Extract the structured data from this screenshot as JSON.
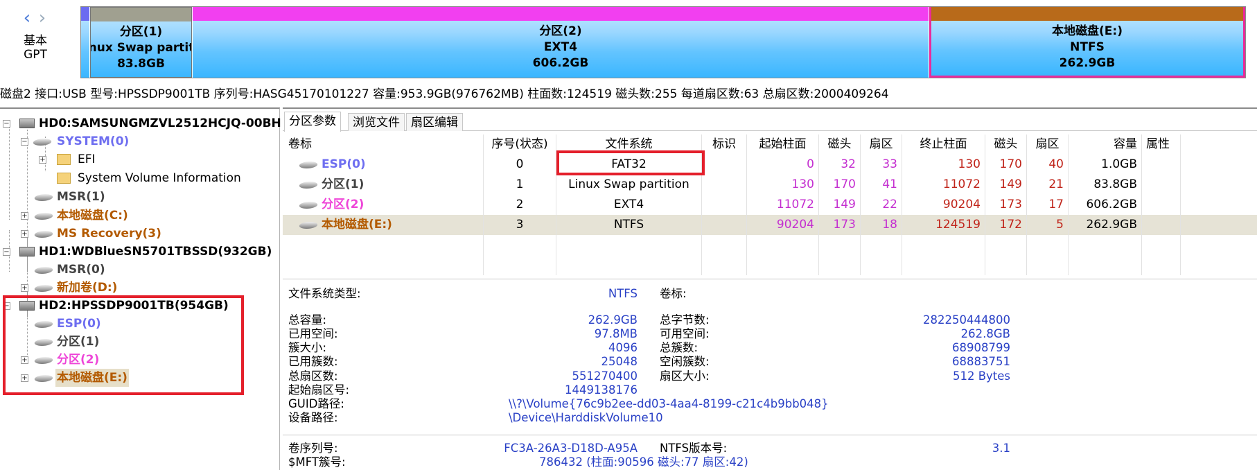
{
  "disk_map": {
    "basic": "基本",
    "gpt": "GPT",
    "segments": [
      {
        "name": "分区(1)",
        "fs": "Linux Swap partition",
        "size": "83.8GB"
      },
      {
        "name": "分区(2)",
        "fs": "EXT4",
        "size": "606.2GB"
      },
      {
        "name": "本地磁盘(E:)",
        "fs": "NTFS",
        "size": "262.9GB"
      }
    ]
  },
  "info_line": "磁盘2 接口:USB  型号:HPSSDP9001TB  序列号:HASG45170101227  容量:953.9GB(976762MB)  柱面数:124519  磁头数:255  每道扇区数:63  总扇区数:2000409264",
  "tree": [
    {
      "label": "HD0:SAMSUNGMZVL2512HCJQ-00BH",
      "color": "#000000"
    },
    {
      "label": "SYSTEM(0)",
      "color": "#6e6ef0"
    },
    {
      "label": "EFI",
      "color": "#000000"
    },
    {
      "label": "System Volume Information",
      "color": "#000000"
    },
    {
      "label": "MSR(1)",
      "color": "#444444"
    },
    {
      "label": "本地磁盘(C:)",
      "color": "#b35a00"
    },
    {
      "label": "MS Recovery(3)",
      "color": "#b35a00"
    },
    {
      "label": "HD1:WDBlueSN5701TBSSD(932GB)",
      "color": "#000000"
    },
    {
      "label": "MSR(0)",
      "color": "#444444"
    },
    {
      "label": "新加卷(D:)",
      "color": "#b35a00"
    },
    {
      "label": "HD2:HPSSDP9001TB(954GB)",
      "color": "#000000"
    },
    {
      "label": "ESP(0)",
      "color": "#6e6ef0"
    },
    {
      "label": "分区(1)",
      "color": "#444444"
    },
    {
      "label": "分区(2)",
      "color": "#ee45d8"
    },
    {
      "label": "本地磁盘(E:)",
      "color": "#b35a00"
    }
  ],
  "tabs": [
    "分区参数",
    "浏览文件",
    "扇区编辑"
  ],
  "table": {
    "headers": [
      "卷标",
      "序号(状态)",
      "文件系统",
      "标识",
      "起始柱面",
      "磁头",
      "扇区",
      "终止柱面",
      "磁头",
      "扇区",
      "容量",
      "属性"
    ],
    "rows": [
      {
        "label": "ESP(0)",
        "index": "0",
        "fs": "FAT32",
        "flag": "",
        "start_cyl": "0",
        "start_head": "32",
        "start_sec": "33",
        "end_cyl": "130",
        "end_head": "170",
        "end_sec": "40",
        "size": "1.0GB",
        "attr": ""
      },
      {
        "label": "分区(1)",
        "index": "1",
        "fs": "Linux Swap partition",
        "flag": "",
        "start_cyl": "130",
        "start_head": "170",
        "start_sec": "41",
        "end_cyl": "11072",
        "end_head": "149",
        "end_sec": "21",
        "size": "83.8GB",
        "attr": ""
      },
      {
        "label": "分区(2)",
        "index": "2",
        "fs": "EXT4",
        "flag": "",
        "start_cyl": "11072",
        "start_head": "149",
        "start_sec": "22",
        "end_cyl": "90204",
        "end_head": "173",
        "end_sec": "17",
        "size": "606.2GB",
        "attr": ""
      },
      {
        "label": "本地磁盘(E:)",
        "index": "3",
        "fs": "NTFS",
        "flag": "",
        "start_cyl": "90204",
        "start_head": "173",
        "start_sec": "18",
        "end_cyl": "124519",
        "end_head": "172",
        "end_sec": "5",
        "size": "262.9GB",
        "attr": ""
      }
    ]
  },
  "details": {
    "fs_type_label": "文件系统类型:",
    "fs_type_value": "NTFS",
    "volume_label_label": "卷标:",
    "total_capacity_label": "总容量:",
    "total_capacity": "262.9GB",
    "used_space_label": "已用空间:",
    "used_space": "97.8MB",
    "cluster_size_label": "簇大小:",
    "cluster_size": "4096",
    "used_clusters_label": "已用簇数:",
    "used_clusters": "25048",
    "total_sectors_label": "总扇区数:",
    "total_sectors": "551270400",
    "start_sector_label": "起始扇区号:",
    "start_sector": "1449138176",
    "guid_path_label": "GUID路径:",
    "guid_path": "\\\\?\\Volume{76c9b2ee-dd03-4aa4-8199-c21c4b9bb048}",
    "device_path_label": "设备路径:",
    "device_path": "\\Device\\HarddiskVolume10",
    "total_bytes_label": "总字节数:",
    "total_bytes": "282250444800",
    "free_space_label": "可用空间:",
    "free_space": "262.8GB",
    "total_clusters_label": "总簇数:",
    "total_clusters": "68908799",
    "free_clusters_label": "空闲簇数:",
    "free_clusters": "68883751",
    "sector_size_label": "扇区大小:",
    "sector_size": "512 Bytes",
    "serial_label": "卷序列号:",
    "serial": "FC3A-26A3-D18D-A95A",
    "ntfs_version_label": "NTFS版本号:",
    "ntfs_version": "3.1",
    "mft_label": "$MFT簇号:",
    "mft": "786432 (柱面:90596 磁头:77 扇区:42)"
  }
}
